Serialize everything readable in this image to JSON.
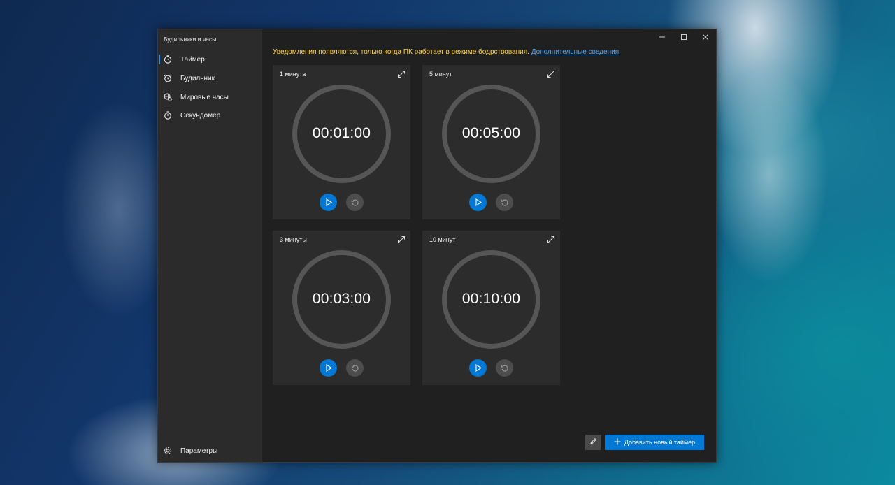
{
  "app": {
    "title": "Будильники и часы"
  },
  "sidebar": {
    "items": [
      {
        "label": "Таймер",
        "icon": "timer-icon",
        "active": true
      },
      {
        "label": "Будильник",
        "icon": "alarm-clock-icon",
        "active": false
      },
      {
        "label": "Мировые часы",
        "icon": "globe-icon",
        "active": false
      },
      {
        "label": "Секундомер",
        "icon": "stopwatch-icon",
        "active": false
      }
    ],
    "settings_label": "Параметры"
  },
  "notice": {
    "text": "Уведомления появляются, только когда ПК работает в режиме бодрствования.",
    "link": "Дополнительные сведения"
  },
  "timers": [
    {
      "name": "1 минута",
      "time": "00:01:00"
    },
    {
      "name": "5 минут",
      "time": "00:05:00"
    },
    {
      "name": "3 минуты",
      "time": "00:03:00"
    },
    {
      "name": "10 минут",
      "time": "00:10:00"
    }
  ],
  "footer": {
    "add_label": "Добавить новый таймер"
  },
  "colors": {
    "accent": "#0078d4",
    "notice": "#ffd43b",
    "link": "#4ca3ef"
  }
}
